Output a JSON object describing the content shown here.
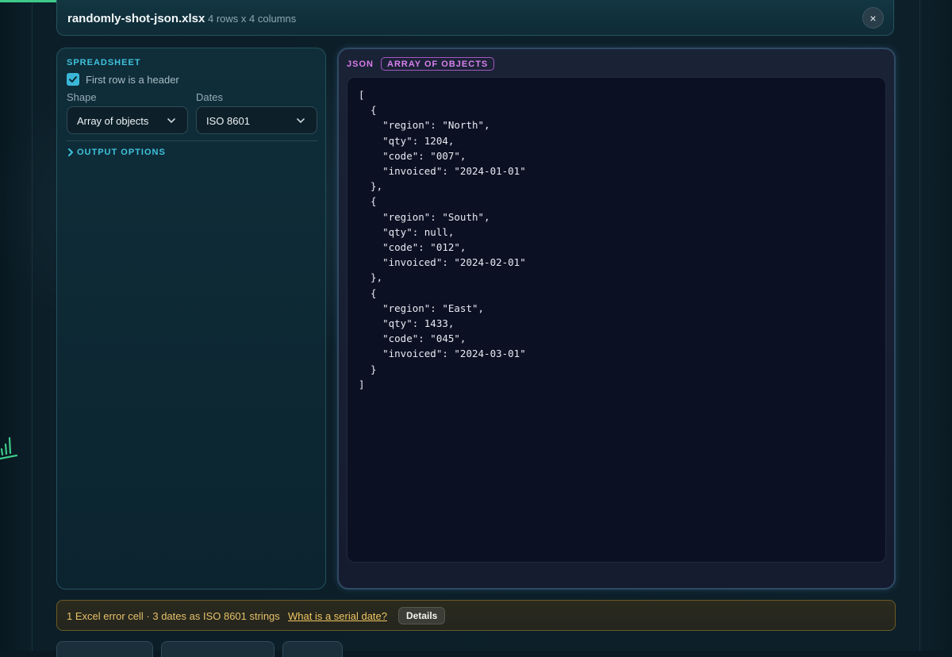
{
  "file": {
    "name": "randomly-shot-json.xlsx",
    "meta": "4 rows x 4 columns",
    "close_label": "×"
  },
  "spreadsheet": {
    "title": "SPREADSHEET",
    "header_checkbox": {
      "label": "First row is a header",
      "checked": true
    },
    "shape": {
      "label": "Shape",
      "value": "Array of objects"
    },
    "dates": {
      "label": "Dates",
      "value": "ISO 8601"
    },
    "output_options_label": "OUTPUT OPTIONS"
  },
  "json_panel": {
    "label": "JSON",
    "badge": "ARRAY OF OBJECTS",
    "code": "[\n  {\n    \"region\": \"North\",\n    \"qty\": 1204,\n    \"code\": \"007\",\n    \"invoiced\": \"2024-01-01\"\n  },\n  {\n    \"region\": \"South\",\n    \"qty\": null,\n    \"code\": \"012\",\n    \"invoiced\": \"2024-02-01\"\n  },\n  {\n    \"region\": \"East\",\n    \"qty\": 1433,\n    \"code\": \"045\",\n    \"invoiced\": \"2024-03-01\"\n  }\n]"
  },
  "status": {
    "text": "1 Excel error cell · 3 dates as ISO 8601 strings",
    "link": "What is a serial date?",
    "details_button": "Details"
  },
  "colors": {
    "accent_cyan": "#3fc2dc",
    "accent_magenta": "#d77be8",
    "warning_amber": "#e7c069",
    "progress_green": "#3ec98a"
  }
}
